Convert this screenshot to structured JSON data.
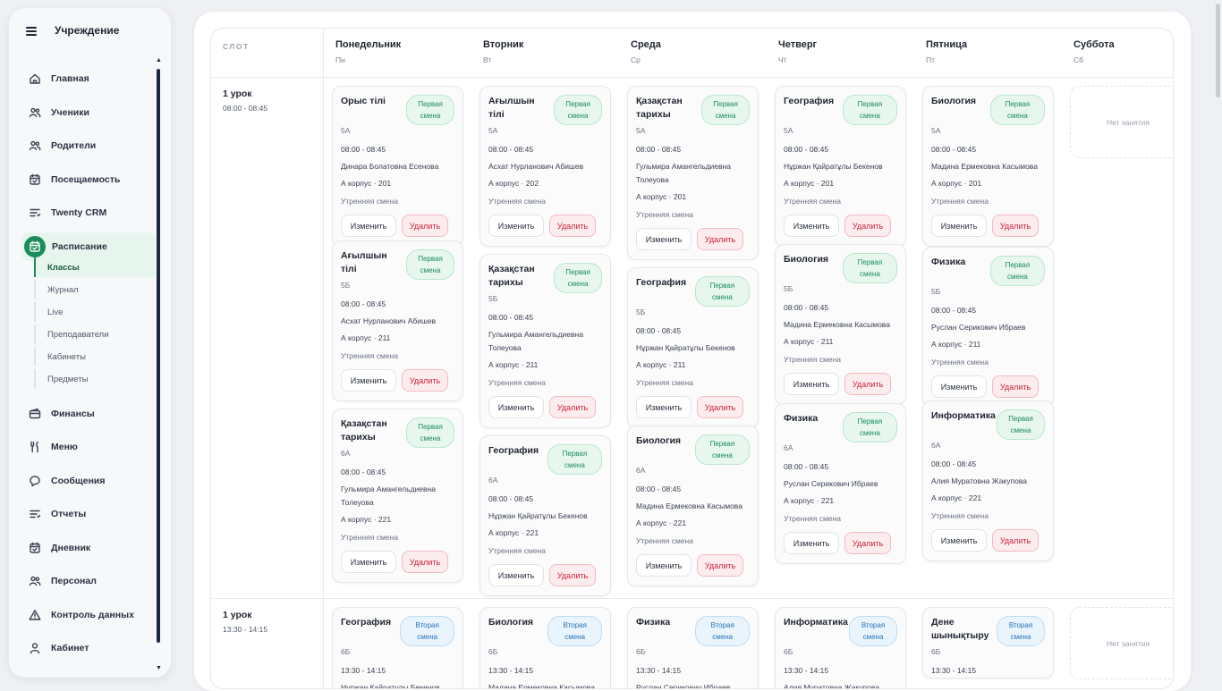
{
  "sidebar": {
    "title": "Учреждение",
    "items": [
      {
        "label": "Главная",
        "icon": "home-icon"
      },
      {
        "label": "Ученики",
        "icon": "users-icon"
      },
      {
        "label": "Родители",
        "icon": "users-icon"
      },
      {
        "label": "Посещаемость",
        "icon": "calendar-icon"
      },
      {
        "label": "Twenty CRM",
        "icon": "list-icon"
      },
      {
        "label": "Расписание",
        "icon": "calendar-icon"
      },
      {
        "label": "Финансы",
        "icon": "wallet-icon"
      },
      {
        "label": "Меню",
        "icon": "utensils-icon"
      },
      {
        "label": "Сообщения",
        "icon": "chat-icon"
      },
      {
        "label": "Отчеты",
        "icon": "list-icon"
      },
      {
        "label": "Дневник",
        "icon": "calendar-icon"
      },
      {
        "label": "Персонал",
        "icon": "users-icon"
      },
      {
        "label": "Контроль данных",
        "icon": "warning-icon"
      },
      {
        "label": "Кабинет",
        "icon": "user-icon"
      }
    ],
    "subitems": [
      "Классы",
      "Журнал",
      "Live",
      "Преподаватели",
      "Кабинеты",
      "Предметы"
    ]
  },
  "header": {
    "slot": "СЛОТ",
    "days": [
      {
        "name": "Понедельник",
        "short": "Пн"
      },
      {
        "name": "Вторник",
        "short": "Вт"
      },
      {
        "name": "Среда",
        "short": "Ср"
      },
      {
        "name": "Четверг",
        "short": "Чт"
      },
      {
        "name": "Пятница",
        "short": "Пт"
      },
      {
        "name": "Суббота",
        "short": "Сб"
      }
    ]
  },
  "rows": [
    {
      "title": "1 урок",
      "time": "08:00 - 08:45",
      "empty": "Нет занятия"
    },
    {
      "title": "1 урок",
      "time": "13:30 - 14:15",
      "empty": "Нет занятия"
    }
  ],
  "actions": {
    "edit": "Изменить",
    "delete": "Удалить"
  },
  "cards": [
    {
      "subject": "Орыс тілі",
      "badge": "Первая смена",
      "cls": "5А",
      "time": "08:00 - 08:45",
      "teacher": "Динара Болатовна Есенова",
      "room": "А корпус · 201",
      "shift": "Утренняя смена"
    },
    {
      "subject": "Ағылшын тілі",
      "badge": "Первая смена",
      "cls": "5Б",
      "time": "08:00 - 08:45",
      "teacher": "Асхат Нурланович Абишев",
      "room": "А корпус · 211",
      "shift": "Утренняя смена"
    },
    {
      "subject": "Қазақстан тарихы",
      "badge": "Первая смена",
      "cls": "6А",
      "time": "08:00 - 08:45",
      "teacher": "Гульмира Амангельдиевна Толеуова",
      "room": "А корпус · 221",
      "shift": "Утренняя смена"
    },
    {
      "subject": "Ағылшын тілі",
      "badge": "Первая смена",
      "cls": "5А",
      "time": "08:00 - 08:45",
      "teacher": "Асхат Нурланович Абишев",
      "room": "А корпус · 202",
      "shift": "Утренняя смена"
    },
    {
      "subject": "Қазақстан тарихы",
      "badge": "Первая смена",
      "cls": "5Б",
      "time": "08:00 - 08:45",
      "teacher": "Гульмира Амангельдиевна Толеуова",
      "room": "А корпус · 211",
      "shift": "Утренняя смена"
    },
    {
      "subject": "География",
      "badge": "Первая смена",
      "cls": "6А",
      "time": "08:00 - 08:45",
      "teacher": "Нұржан Қайратұлы Бекенов",
      "room": "А корпус · 221",
      "shift": "Утренняя смена"
    },
    {
      "subject": "Қазақстан тарихы",
      "badge": "Первая смена",
      "cls": "5А",
      "time": "08:00 - 08:45",
      "teacher": "Гульмира Амангельдиевна Толеуова",
      "room": "А корпус · 201",
      "shift": "Утренняя смена"
    },
    {
      "subject": "География",
      "badge": "Первая смена",
      "cls": "5Б",
      "time": "08:00 - 08:45",
      "teacher": "Нұржан Қайратұлы Бекенов",
      "room": "А корпус · 211",
      "shift": "Утренняя смена"
    },
    {
      "subject": "Биология",
      "badge": "Первая смена",
      "cls": "6А",
      "time": "08:00 - 08:45",
      "teacher": "Мадина Ермековна Касымова",
      "room": "А корпус · 221",
      "shift": "Утренняя смена"
    },
    {
      "subject": "География",
      "badge": "Первая смена",
      "cls": "5А",
      "time": "08:00 - 08:45",
      "teacher": "Нұржан Қайратұлы Бекенов",
      "room": "А корпус · 201",
      "shift": "Утренняя смена"
    },
    {
      "subject": "Биология",
      "badge": "Первая смена",
      "cls": "5Б",
      "time": "08:00 - 08:45",
      "teacher": "Мадина Ермековна Касымова",
      "room": "А корпус · 211",
      "shift": "Утренняя смена"
    },
    {
      "subject": "Физика",
      "badge": "Первая смена",
      "cls": "6А",
      "time": "08:00 - 08:45",
      "teacher": "Руслан Серикович Ибраев",
      "room": "А корпус · 221",
      "shift": "Утренняя смена"
    },
    {
      "subject": "Биология",
      "badge": "Первая смена",
      "cls": "5А",
      "time": "08:00 - 08:45",
      "teacher": "Мадина Ермековна Касымова",
      "room": "А корпус · 201",
      "shift": "Утренняя смена"
    },
    {
      "subject": "Физика",
      "badge": "Первая смена",
      "cls": "5Б",
      "time": "08:00 - 08:45",
      "teacher": "Руслан Серикович Ибраев",
      "room": "А корпус · 211",
      "shift": "Утренняя смена"
    },
    {
      "subject": "Информатика",
      "badge": "Первая смена",
      "cls": "6А",
      "time": "08:00 - 08:45",
      "teacher": "Алия Муратовна Жакупова",
      "room": "А корпус · 221",
      "shift": "Утренняя смена"
    },
    {
      "subject": "География",
      "badge": "Вторая смена",
      "cls": "6Б",
      "time": "13:30 - 14:15",
      "teacher": "Нұржан Қайратұлы Бекенов"
    },
    {
      "subject": "Биология",
      "badge": "Вторая смена",
      "cls": "6Б",
      "time": "13:30 - 14:15",
      "teacher": "Мадина Ермековна Касымова"
    },
    {
      "subject": "Физика",
      "badge": "Вторая смена",
      "cls": "6Б",
      "time": "13:30 - 14:15",
      "teacher": "Руслан Серикович Ибраев"
    },
    {
      "subject": "Информатика",
      "badge": "Вторая смена",
      "cls": "6Б",
      "time": "13:30 - 14:15",
      "teacher": "Алия Муратовна Жакупова"
    },
    {
      "subject": "Дене шынықтыру",
      "badge": "Вторая смена",
      "cls": "6Б",
      "time": "13:30 - 14:15",
      "teacher": ""
    }
  ]
}
